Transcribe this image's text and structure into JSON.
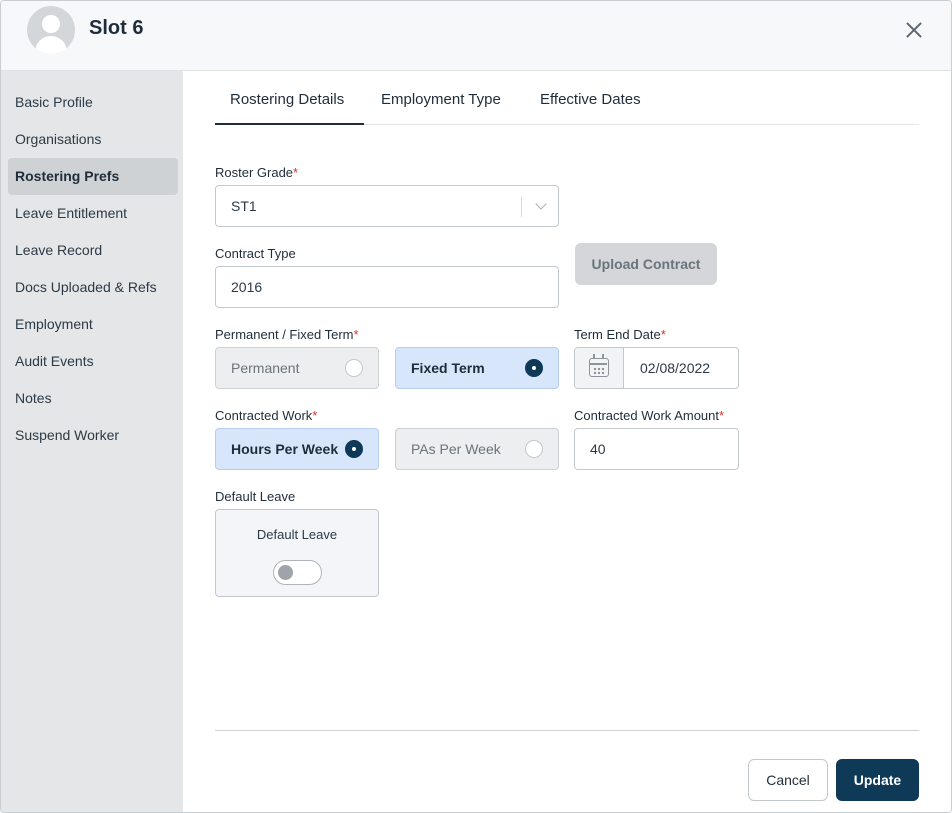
{
  "header": {
    "title": "Slot 6",
    "avatar_icon": "user-avatar-icon",
    "close_icon": "close-icon"
  },
  "sidebar": {
    "items": [
      {
        "label": "Basic Profile"
      },
      {
        "label": "Organisations"
      },
      {
        "label": "Rostering Prefs",
        "active": true
      },
      {
        "label": "Leave Entitlement"
      },
      {
        "label": "Leave Record"
      },
      {
        "label": "Docs Uploaded & Refs"
      },
      {
        "label": "Employment"
      },
      {
        "label": "Audit Events"
      },
      {
        "label": "Notes"
      },
      {
        "label": "Suspend Worker"
      }
    ]
  },
  "tabs": [
    {
      "label": "Rostering Details",
      "active": true
    },
    {
      "label": "Employment Type"
    },
    {
      "label": "Effective Dates"
    }
  ],
  "form": {
    "roster_grade": {
      "label": "Roster Grade",
      "required_mark": "*",
      "value": "ST1"
    },
    "contract_type": {
      "label": "Contract Type",
      "value": "2016"
    },
    "upload_contract_label": "Upload Contract",
    "permanent_fixed": {
      "label": "Permanent / Fixed Term",
      "required_mark": "*",
      "options": [
        {
          "label": "Permanent",
          "selected": false
        },
        {
          "label": "Fixed Term",
          "selected": true
        }
      ]
    },
    "term_end_date": {
      "label": "Term End Date",
      "required_mark": "*",
      "value": "02/08/2022",
      "icon": "calendar-icon"
    },
    "contracted_work": {
      "label": "Contracted Work",
      "required_mark": "*",
      "options": [
        {
          "label": "Hours Per Week",
          "selected": true
        },
        {
          "label": "PAs Per Week",
          "selected": false
        }
      ]
    },
    "contracted_work_amount": {
      "label": "Contracted Work Amount",
      "required_mark": "*",
      "value": "40"
    },
    "default_leave": {
      "label": "Default Leave",
      "card_label": "Default Leave",
      "enabled": false
    }
  },
  "footer": {
    "cancel_label": "Cancel",
    "update_label": "Update"
  },
  "colors": {
    "primary": "#0e3a57",
    "selected_bg": "#d8e6fb",
    "required": "#d9302c"
  }
}
